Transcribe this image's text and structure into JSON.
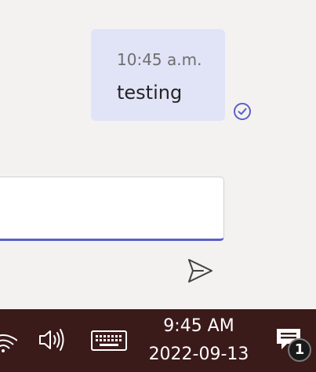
{
  "chat": {
    "message": {
      "time": "10:45 a.m.",
      "text": "testing"
    },
    "colors": {
      "background": "#f3f2f1",
      "bubble": "#e1e3f7",
      "accent": "#5b5fc7"
    },
    "icons": {
      "read_receipt": "check-circle-icon",
      "send": "send-icon"
    }
  },
  "compose": {
    "value": ""
  },
  "taskbar": {
    "background": "#3b1a1a",
    "icons": [
      "network-icon",
      "volume-icon",
      "touch-keyboard-icon",
      "notification-icon"
    ],
    "time": "9:45 AM",
    "date": "2022-09-13",
    "notification_count": "1"
  }
}
